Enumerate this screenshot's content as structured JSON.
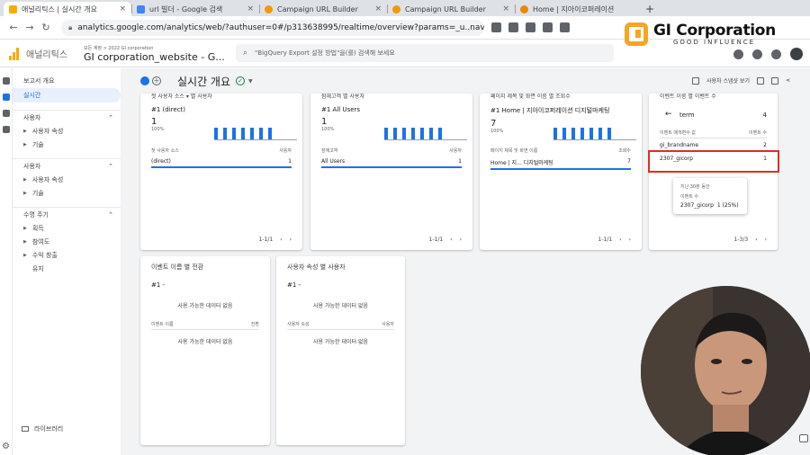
{
  "browser": {
    "tabs": [
      {
        "title": "애널리틱스 | 실시간 개요",
        "active": true,
        "favicon_color": "#f9ab00"
      },
      {
        "title": "url 빌더 - Google 검색",
        "active": false,
        "favicon_color": "#4285f4"
      },
      {
        "title": "Campaign URL Builder",
        "active": false,
        "favicon_color": "#f29900"
      },
      {
        "title": "Campaign URL Builder",
        "active": false,
        "favicon_color": "#f29900"
      },
      {
        "title": "Home | 지아이코퍼레이션",
        "active": false,
        "favicon_color": "#ea8600"
      }
    ],
    "new_tab": "+",
    "url": "analytics.google.com/analytics/web/?authuser=0#/p313638995/realtime/overview?params=_u..nav..."
  },
  "ga": {
    "app_title": "애널리틱스",
    "account_crumb": "모든 계정 > 2022 GI corporation",
    "property": "GI corporation_website - G...",
    "search_placeholder": "\"BigQuery Export 설정 방법\"을(를) 검색해 보세요"
  },
  "brand": {
    "name": "GI Corporation",
    "tagline": "GOOD INFLUENCE"
  },
  "nav": {
    "overview": "보고서 개요",
    "realtime": "실시간",
    "sections": [
      {
        "title": "사용자",
        "items": [
          "사용자 속성",
          "기술"
        ]
      },
      {
        "title": "사용자",
        "items": [
          "사용자 속성",
          "기술"
        ]
      },
      {
        "title": "수명 주기",
        "items": [
          "획득",
          "참여도",
          "수익 창출",
          "유지"
        ]
      }
    ],
    "library": "라이브러리"
  },
  "main": {
    "title": "실시간 개요",
    "user_snapshot": "사용자 스냅샷 보기",
    "cards": [
      {
        "head": "첫 사용자 소스 ▾ 별 사용자",
        "rank": "#1 (direct)",
        "value": "1",
        "pct": "100%",
        "col1": "첫 사용자 소스",
        "col2": "사용자",
        "row_label": "(direct)",
        "row_value": "1",
        "pager": "1-1/1"
      },
      {
        "head": "잠재고객 별 사용자",
        "rank": "#1 All Users",
        "value": "1",
        "pct": "100%",
        "col1": "잠재고객",
        "col2": "사용자",
        "row_label": "All Users",
        "row_value": "1",
        "pager": "1-1/1"
      },
      {
        "head": "페이지 제목 및 화면 이름 별 조회수",
        "rank": "#1 Home | 지아이코퍼레이션 디지털마케팅",
        "value": "7",
        "pct": "100%",
        "col1": "페이지 제목 및 화면 이름",
        "col2": "조회수",
        "row_label": "Home | 지... 디지털마케팅",
        "row_value": "7",
        "pager": "1-1/1"
      },
      {
        "head": "이벤트 이름 별 이벤트 수",
        "back": "←",
        "term_label": "term",
        "term_count": "4",
        "col1": "이벤트 매개변수 값",
        "col2": "이벤트 수",
        "rows": [
          {
            "label": "gi_brandname",
            "value": "2"
          },
          {
            "label": "2307_gicorp",
            "value": "1"
          }
        ],
        "tooltip": {
          "line1": "지난 30분 동안",
          "line2": "이벤트 수",
          "line3_label": "2307_gicorp",
          "line3_value": "1 (25%)"
        },
        "pager": "1-3/3"
      },
      {
        "head": "이벤트 이름 별 전환",
        "rank": "#1 -",
        "nodata": "사용 가능한 데이터 없음",
        "col1": "이벤트 이름",
        "col2": "전환",
        "nodata2": "사용 가능한 데이터 없음"
      },
      {
        "head": "사용자 속성 별 사용자",
        "rank": "#1 -",
        "nodata": "사용 가능한 데이터 없음",
        "col1": "사용자 속성",
        "col2": "사용자",
        "nodata2": "사용 가능한 데이터 없음"
      }
    ]
  },
  "icons": [
    "back-icon",
    "forward-icon",
    "reload-icon",
    "lock-icon",
    "search-icon",
    "help-icon",
    "apps-icon",
    "settings-icon",
    "share-icon",
    "compare-icon",
    "check-icon"
  ]
}
